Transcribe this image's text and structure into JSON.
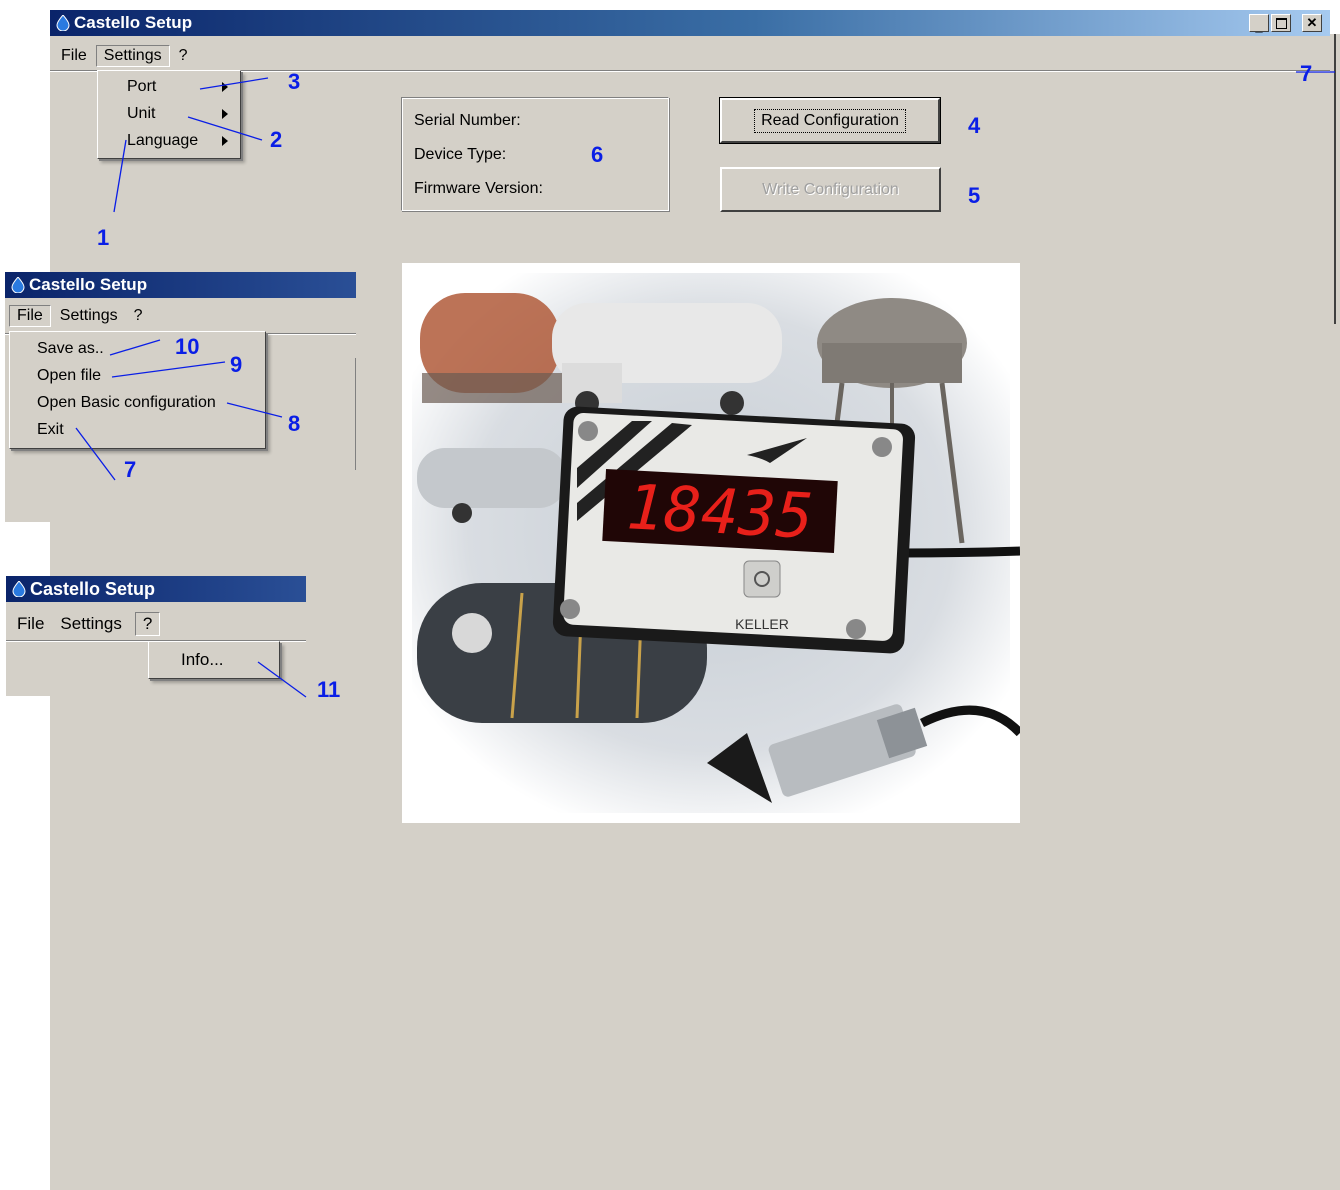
{
  "main_window": {
    "title": "Castello Setup",
    "menu": [
      "File",
      "Settings",
      "?"
    ],
    "settings_menu": [
      "Port",
      "Unit",
      "Language"
    ],
    "info": {
      "serial_number_label": "Serial Number:",
      "device_type_label": "Device Type:",
      "firmware_version_label": "Firmware Version:"
    },
    "buttons": {
      "read": "Read Configuration",
      "write": "Write Configuration"
    },
    "photo": {
      "display_value": "18435",
      "brand": "KELLER"
    }
  },
  "file_window": {
    "title": "Castello Setup",
    "menu": [
      "File",
      "Settings",
      "?"
    ],
    "file_menu": [
      "Save as..",
      "Open file",
      "Open Basic configuration",
      "Exit"
    ]
  },
  "help_window": {
    "title": "Castello Setup",
    "menu": [
      "File",
      "Settings",
      "?"
    ],
    "help_menu": [
      "Info..."
    ]
  },
  "callouts": {
    "n1": "1",
    "n2": "2",
    "n3": "3",
    "n4": "4",
    "n5": "5",
    "n6": "6",
    "n7_main": "7",
    "n7_file": "7",
    "n8": "8",
    "n9": "9",
    "n10": "10",
    "n11": "11"
  },
  "colors": {
    "window_bg": "#d4d0c8",
    "title_dark": "#0a246a",
    "callout": "#0a1ee6",
    "led": "#e8201a"
  }
}
